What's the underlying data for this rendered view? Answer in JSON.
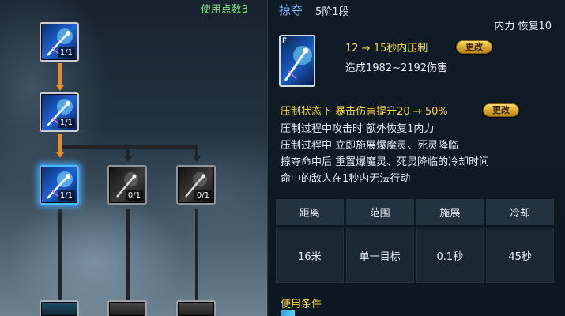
{
  "tree": {
    "points_used": "使用点数3",
    "nodes": [
      {
        "level": "1/1",
        "icon": "lightning-spear-icon"
      },
      {
        "level": "1/1",
        "icon": "lightning-spear-icon"
      },
      {
        "level": "1/1",
        "icon": "lightning-spear-icon"
      },
      {
        "level": "0/1",
        "icon": "dark-blade-icon"
      },
      {
        "level": "0/1",
        "icon": "dark-blade-icon"
      }
    ]
  },
  "skill": {
    "name": "掠夺",
    "tier": "5阶1段",
    "cost": "内力 恢复10",
    "icon_tag": "F",
    "line1": "12 → 15秒内压制",
    "change_label": "更改",
    "line2": "造成1982~2192伤害",
    "effect_header": "压制状态下 暴击伤害提升20 → 50%",
    "effects": [
      "压制过程中攻击时 额外恢复1内力",
      "压制过程中 立即施展爆魔灵、死灵降临",
      "掠夺命中后 重置爆魔灵、死灵降临的冷却时间",
      "命中的敌人在1秒内无法行动"
    ]
  },
  "stats": {
    "headers": [
      "距离",
      "范围",
      "施展",
      "冷却"
    ],
    "values": [
      "16米",
      "单一目标",
      "0.1秒",
      "45秒"
    ]
  },
  "conditions": {
    "title": "使用条件"
  },
  "colors": {
    "accent_blue": "#6fb8ff",
    "gold_text": "#f3d43f",
    "green_text": "#7fe07a",
    "orange_connector": "#ee8a25"
  }
}
